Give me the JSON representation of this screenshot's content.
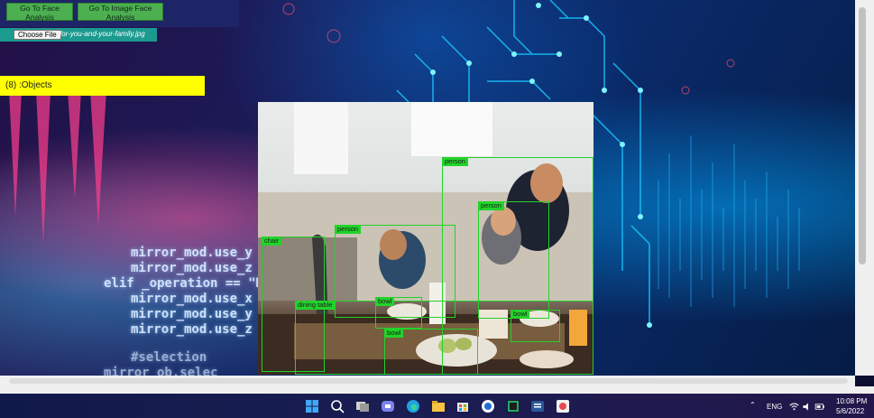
{
  "nav": {
    "face_analysis_label": "Go To Face Analysis",
    "image_face_analysis_label": "Go To Image Face Analysis"
  },
  "upload": {
    "button_label": "Choose File",
    "file_name": "for-you-and-your-family.jpg"
  },
  "objects_header": "(8) :Objects",
  "detections": [
    {
      "label": "person"
    },
    {
      "label": "person"
    },
    {
      "label": "person"
    },
    {
      "label": "chair"
    },
    {
      "label": "dining table"
    },
    {
      "label": "bowl"
    },
    {
      "label": "bowl"
    },
    {
      "label": "bowl"
    }
  ],
  "background_code": [
    "mirror_mod.use_y",
    "mirror_mod.use_z =",
    "elif _operation == \"MI",
    "mirror_mod.use_x =",
    "mirror_mod.use_y =",
    "mirror_mod.use_z =",
    "#selection",
    "mirror_ob.selec"
  ],
  "taskbar": {
    "language": "ENG",
    "time": "10:08 PM",
    "date": "5/6/2022",
    "icons": [
      "windows-start-icon",
      "search-icon",
      "task-view-icon",
      "teams-chat-icon",
      "edge-icon",
      "file-explorer-icon",
      "store-icon",
      "app-icon",
      "pycharm-icon",
      "word-icon",
      "snipping-tool-icon"
    ]
  },
  "colors": {
    "detection": "#22d32a",
    "objects_bar": "#ffff00",
    "nav_button": "#4caf50"
  }
}
